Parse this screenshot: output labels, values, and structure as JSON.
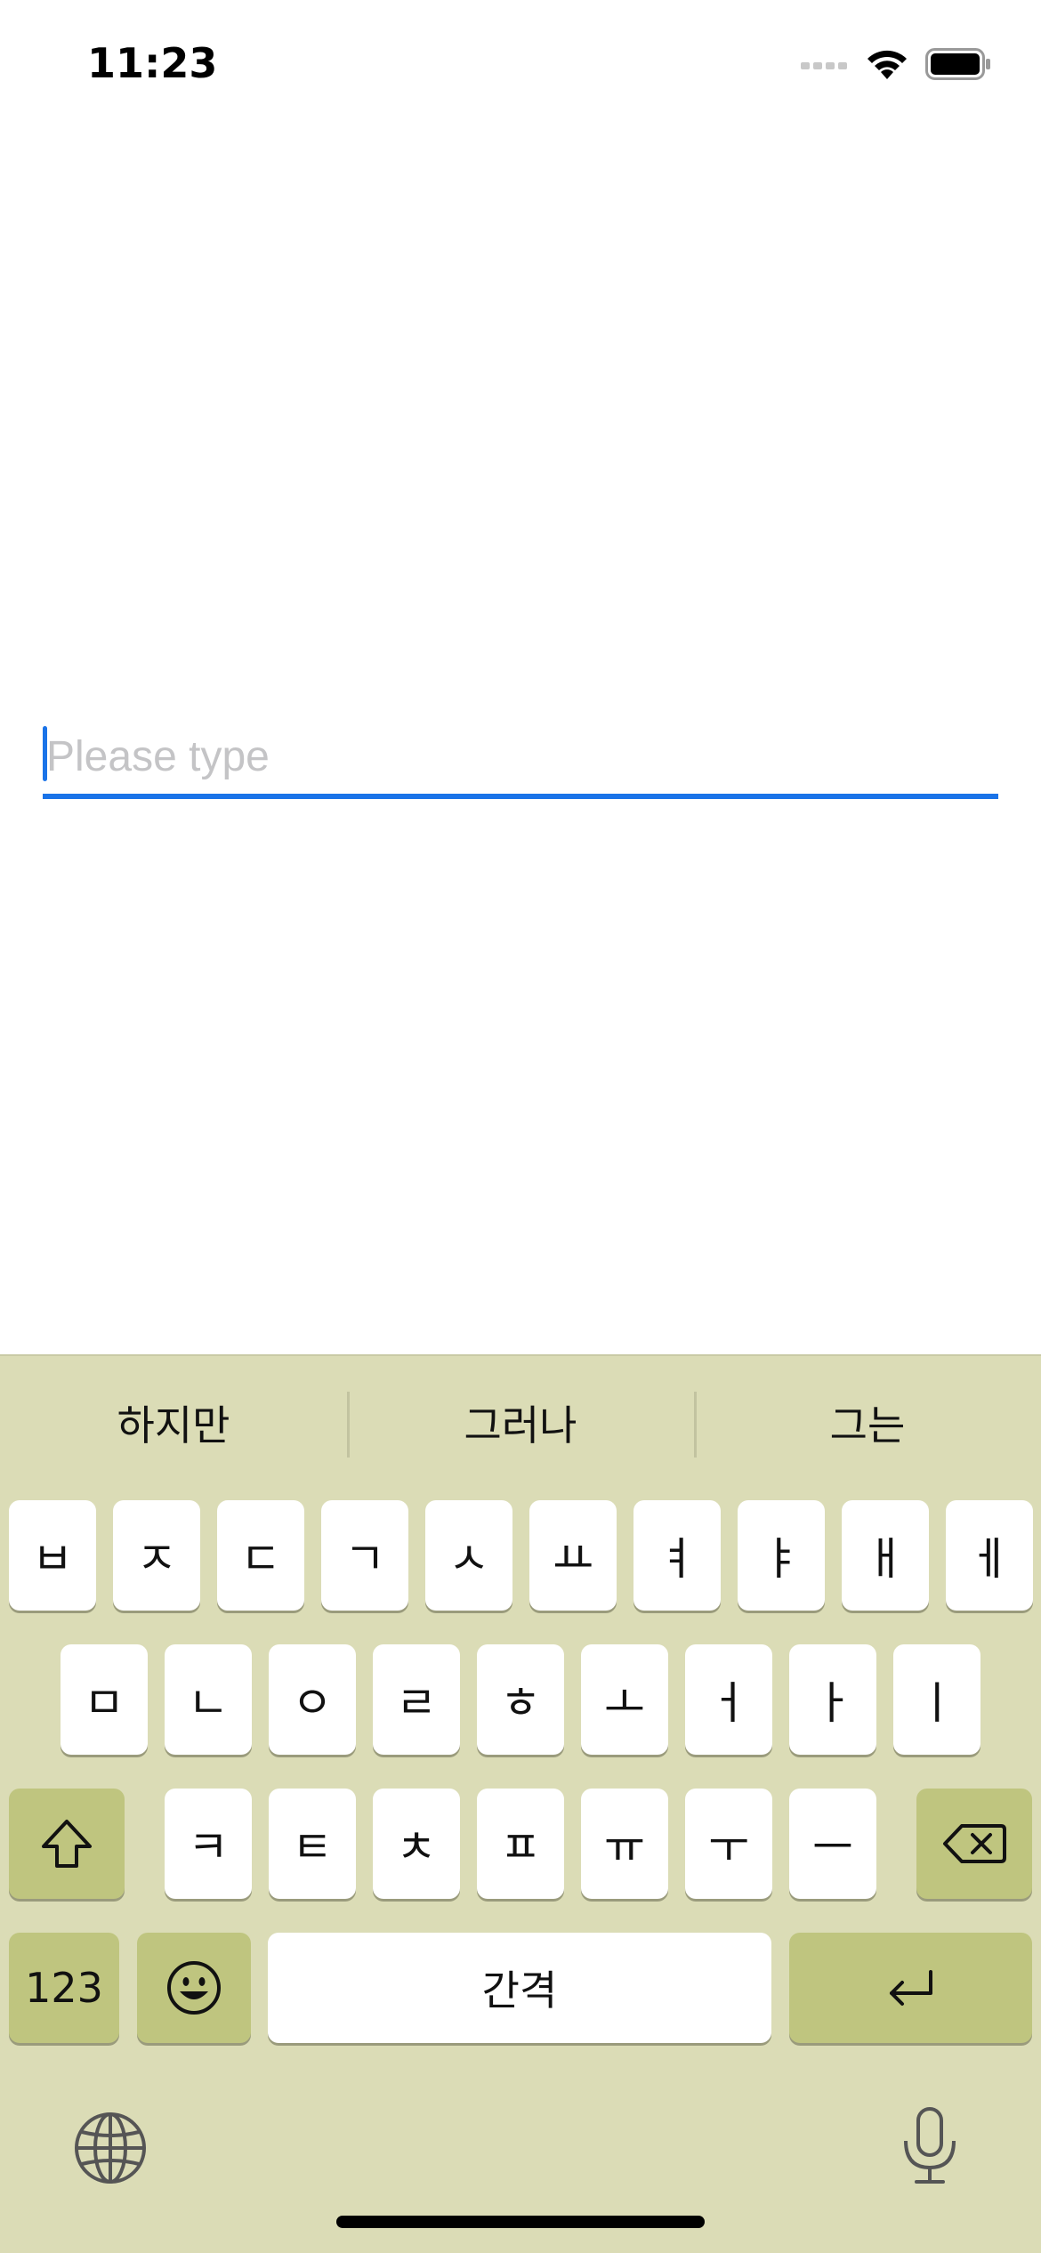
{
  "status_bar": {
    "time": "11:23",
    "signal_icon": "cellular-signal-icon",
    "wifi_icon": "wifi-icon",
    "battery_icon": "battery-icon"
  },
  "text_field": {
    "placeholder": "Please type",
    "value": ""
  },
  "colors": {
    "accent": "#1a73e8",
    "keyboard_bg": "#dbdcb6",
    "function_key": "#bfc57f"
  },
  "keyboard": {
    "suggestions": [
      "하지만",
      "그러나",
      "그는"
    ],
    "row1": [
      "ㅂ",
      "ㅈ",
      "ㄷ",
      "ㄱ",
      "ㅅ",
      "ㅛ",
      "ㅕ",
      "ㅑ",
      "ㅐ",
      "ㅔ"
    ],
    "row2": [
      "ㅁ",
      "ㄴ",
      "ㅇ",
      "ㄹ",
      "ㅎ",
      "ㅗ",
      "ㅓ",
      "ㅏ",
      "ㅣ"
    ],
    "row3": [
      "ㅋ",
      "ㅌ",
      "ㅊ",
      "ㅍ",
      "ㅠ",
      "ㅜ",
      "ㅡ"
    ],
    "numbers_key": "123",
    "space_key": "간격",
    "shift_icon": "shift-icon",
    "delete_icon": "delete-backspace-icon",
    "emoji_icon": "emoji-icon",
    "return_icon": "return-icon",
    "globe_icon": "globe-icon",
    "mic_icon": "microphone-icon"
  }
}
